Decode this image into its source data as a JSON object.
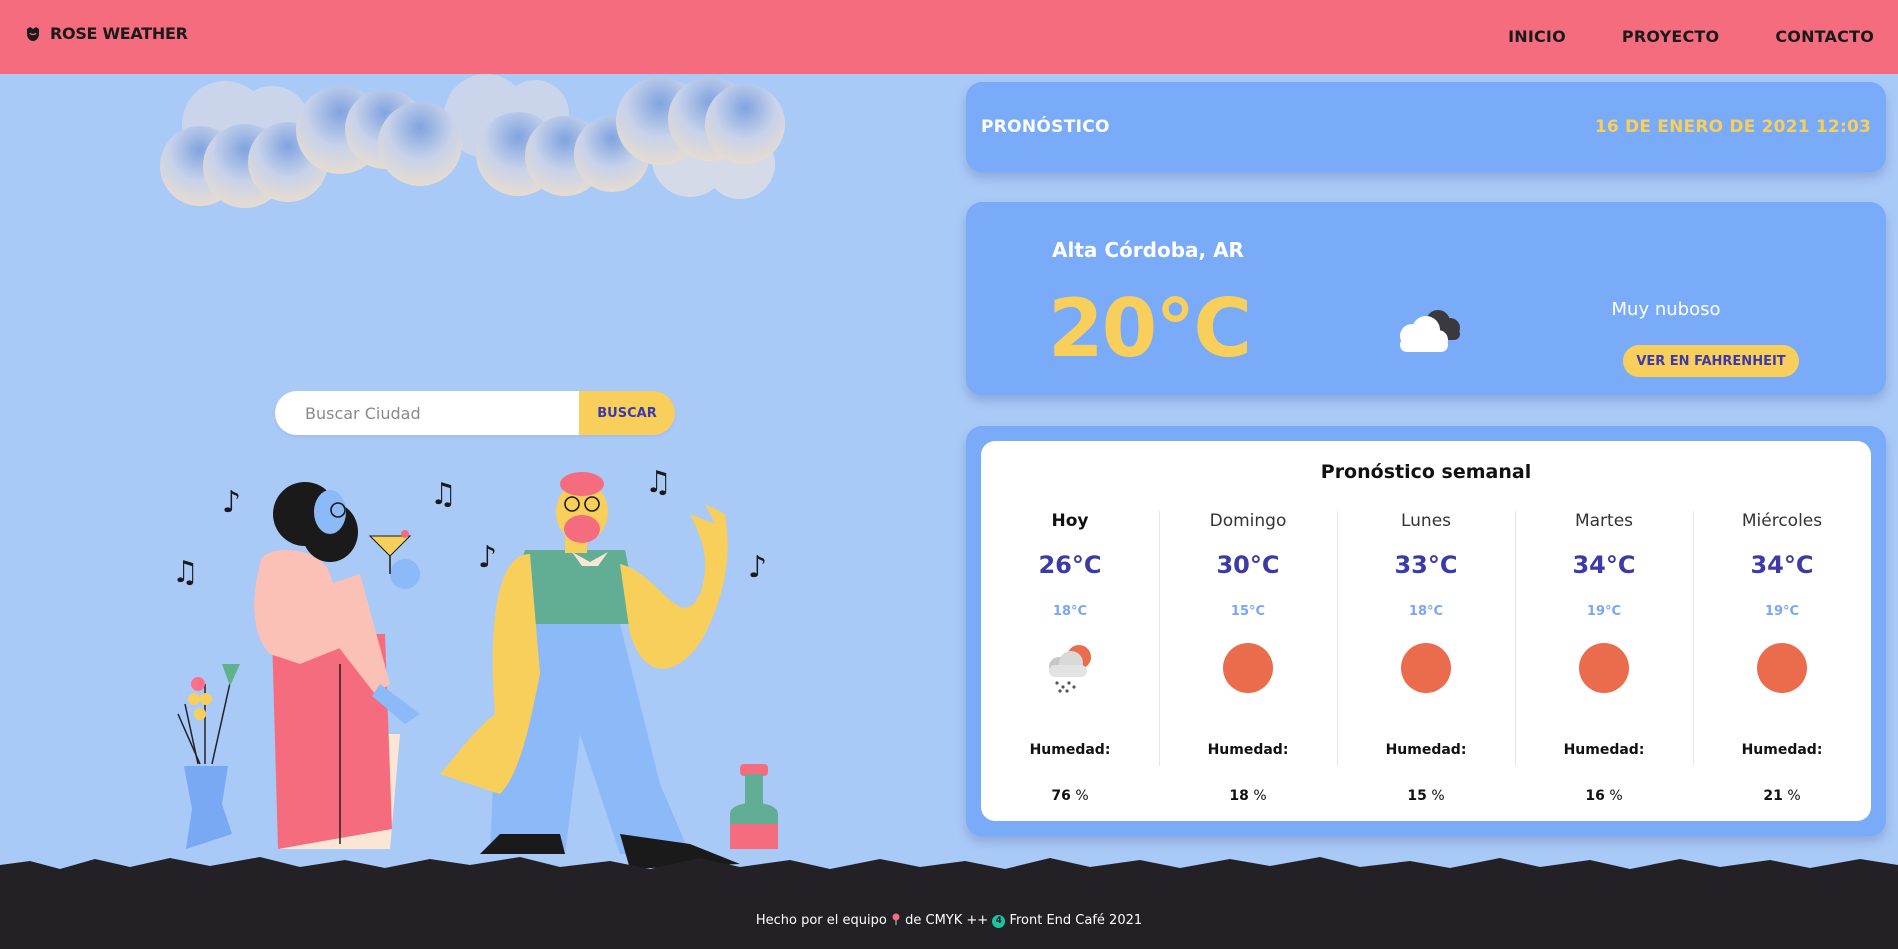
{
  "header": {
    "brand": "ROSE WEATHER",
    "nav": [
      "INICIO",
      "PROYECTO",
      "CONTACTO"
    ]
  },
  "search": {
    "placeholder": "Buscar Ciudad",
    "button": "BUSCAR"
  },
  "forecast_header": {
    "title": "PRONÓSTICO",
    "datetime": "16 DE ENERO DE 2021 12:03"
  },
  "current": {
    "location": "Alta Córdoba, AR",
    "temperature": "20°C",
    "description": "Muy nuboso",
    "unit_button": "VER EN FAHRENHEIT",
    "icon": "mostly-cloudy-icon"
  },
  "weekly": {
    "title": "Pronóstico semanal",
    "humidity_label": "Humedad:",
    "days": [
      {
        "name": "Hoy",
        "max": "26°C",
        "min": "18°C",
        "humidity": "76",
        "icon": "rain-sun-icon"
      },
      {
        "name": "Domingo",
        "max": "30°C",
        "min": "15°C",
        "humidity": "18",
        "icon": "sun-icon"
      },
      {
        "name": "Lunes",
        "max": "33°C",
        "min": "18°C",
        "humidity": "15",
        "icon": "sun-icon"
      },
      {
        "name": "Martes",
        "max": "34°C",
        "min": "19°C",
        "humidity": "16",
        "icon": "sun-icon"
      },
      {
        "name": "Miércoles",
        "max": "34°C",
        "min": "19°C",
        "humidity": "21",
        "icon": "sun-icon"
      }
    ],
    "percent": "%"
  },
  "footer": {
    "part1": "Hecho por el equipo",
    "part2": "de CMYK ++",
    "badge": "4",
    "part3": "Front End Café 2021"
  },
  "colors": {
    "header_bg": "#f46c7e",
    "page_bg": "#a9c9f7",
    "card_bg": "#79abf9",
    "accent_yellow": "#f9cf5c",
    "accent_indigo": "#3c3aa6",
    "sun": "#eb6b4d",
    "footer_bg": "#232126"
  }
}
